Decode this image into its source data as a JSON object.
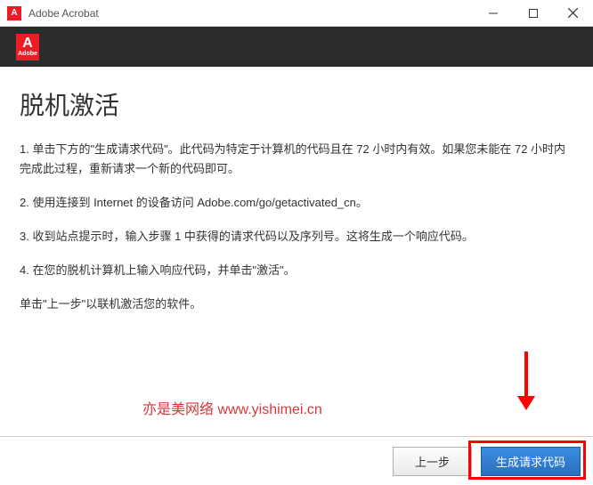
{
  "titlebar": {
    "icon_letter": "A",
    "title": "Adobe Acrobat"
  },
  "logo": {
    "letter": "A",
    "brand": "Adobe"
  },
  "content": {
    "heading": "脱机激活",
    "step1": "1. 单击下方的\"生成请求代码\"。此代码为特定于计算机的代码且在 72 小时内有效。如果您未能在 72 小时内完成此过程，重新请求一个新的代码即可。",
    "step2": "2. 使用连接到 Internet 的设备访问 Adobe.com/go/getactivated_cn。",
    "step3": "3. 收到站点提示时，输入步骤 1 中获得的请求代码以及序列号。这将生成一个响应代码。",
    "step4": "4. 在您的脱机计算机上输入响应代码，并单击\"激活\"。",
    "note": "单击\"上一步\"以联机激活您的软件。"
  },
  "watermark": "亦是美网络 www.yishimei.cn",
  "footer": {
    "back_label": "上一步",
    "generate_label": "生成请求代码"
  }
}
